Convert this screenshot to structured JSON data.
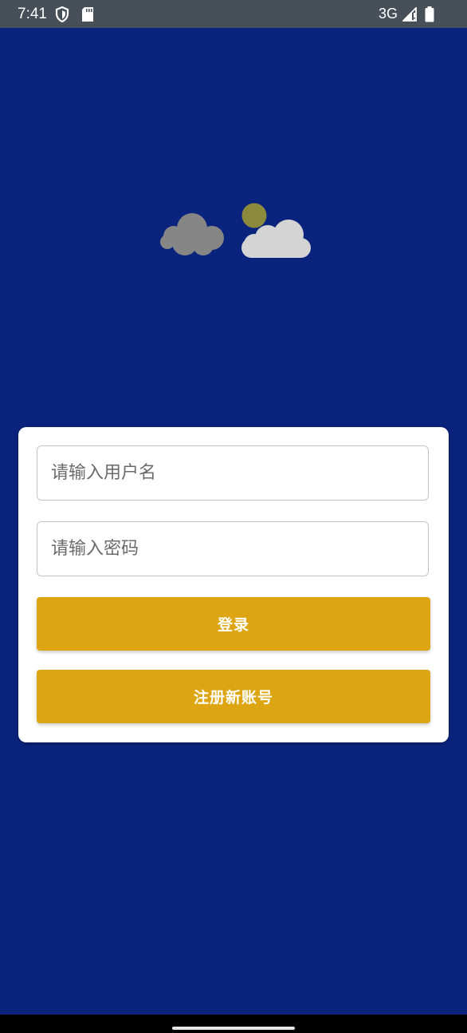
{
  "status_bar": {
    "time": "7:41",
    "network": "3G",
    "icons": [
      "shield-icon",
      "sd-card-icon",
      "signal-icon",
      "battery-icon"
    ]
  },
  "weather_icon": "cloudy-sun-weather-icon",
  "login_form": {
    "username_placeholder": "请输入用户名",
    "password_placeholder": "请输入密码",
    "login_label": "登录",
    "register_label": "注册新账号"
  },
  "colors": {
    "background": "#0a237d",
    "accent_button": "#dea512",
    "status_bar": "#474f59"
  }
}
